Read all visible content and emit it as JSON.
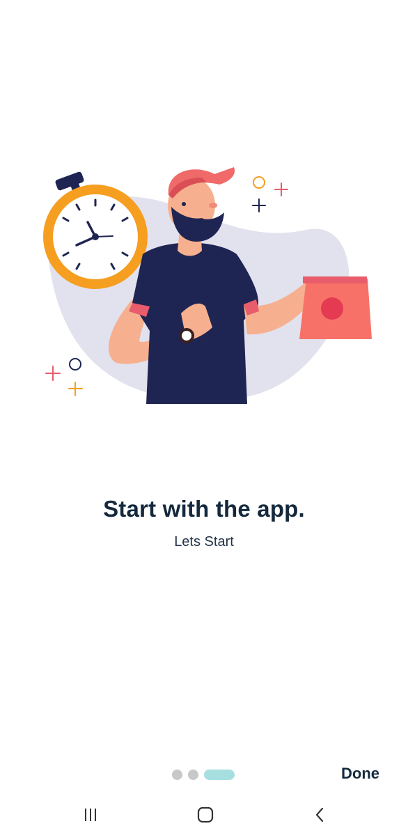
{
  "onboarding": {
    "title": "Start with the app.",
    "subtitle": "Lets Start",
    "done_label": "Done",
    "page_count": 3,
    "current_page": 3
  },
  "illustration": {
    "icon": "delivery-man-stopwatch-illustration"
  },
  "navigation_bar": {
    "recent_apps_icon": "recent-apps-icon",
    "home_icon": "home-icon",
    "back_icon": "back-icon"
  },
  "colors": {
    "text_primary": "#14293d",
    "dot_inactive": "#c8c8c8",
    "dot_active": "#a7dfe0",
    "stopwatch": "#f59e1f",
    "shirt": "#1f2552",
    "cap": "#f06a6a",
    "blob": "#e2e1ee"
  }
}
